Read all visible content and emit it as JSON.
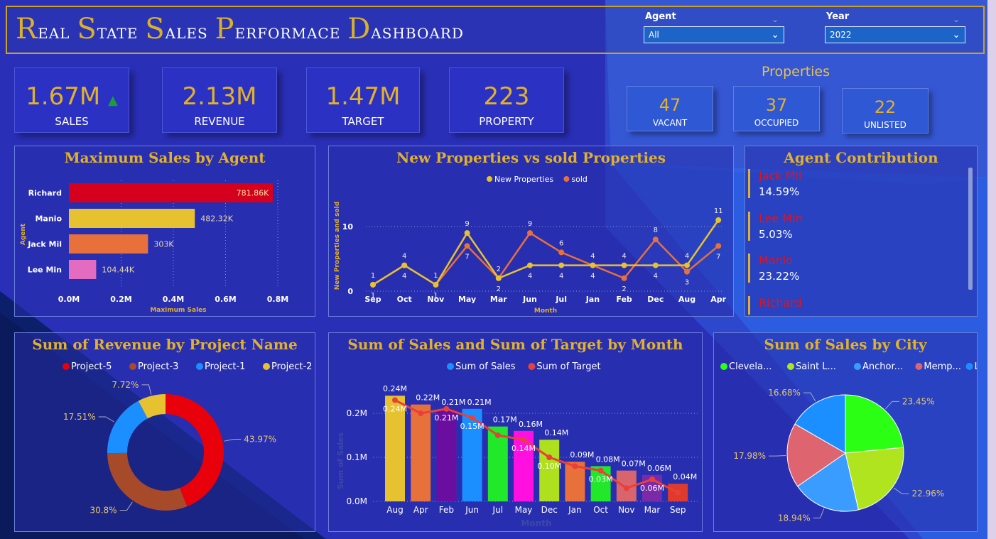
{
  "title": {
    "words": [
      {
        "cap": "R",
        "rest": "eal"
      },
      {
        "cap": "S",
        "rest": "tate"
      },
      {
        "cap": "S",
        "rest": "ales"
      },
      {
        "cap": "P",
        "rest": "erformace"
      },
      {
        "cap": "D",
        "rest": "ashboard"
      }
    ]
  },
  "filters": {
    "agent": {
      "label": "Agent",
      "value": "All"
    },
    "year": {
      "label": "Year",
      "value": "2022"
    }
  },
  "kpis": [
    {
      "value": "1.67M",
      "label": "SALES",
      "trend": "up"
    },
    {
      "value": "2.13M",
      "label": "REVENUE"
    },
    {
      "value": "1.47M",
      "label": "TARGET"
    },
    {
      "value": "223",
      "label": "PROPERTY"
    }
  ],
  "properties": {
    "title": "Properties",
    "items": [
      {
        "value": "47",
        "label": "VACANT"
      },
      {
        "value": "37",
        "label": "OCCUPIED"
      },
      {
        "value": "22",
        "label": "UNLISTED"
      }
    ]
  },
  "colors": {
    "gold": "#e1b12c",
    "red": "#e0141e",
    "accent": "#1c64c8"
  },
  "agent_contribution": {
    "title": "Agent Contribution",
    "items": [
      {
        "name": "Jack Mil",
        "pct": "14.59%"
      },
      {
        "name": "Lee Min",
        "pct": "5.03%"
      },
      {
        "name": "Manio",
        "pct": "23.22%"
      },
      {
        "name": "Richard",
        "pct": ""
      }
    ]
  },
  "chart_data": [
    {
      "id": "max-sales-by-agent",
      "type": "bar",
      "title": "Maximum Sales by Agent",
      "orientation": "horizontal",
      "ylabel": "Agent",
      "xlabel": "Maximum Sales",
      "categories": [
        "Richard",
        "Manio",
        "Jack Mil",
        "Lee Min"
      ],
      "values": [
        781860,
        482320,
        303000,
        104440
      ],
      "value_labels": [
        "781.86K",
        "482.32K",
        "303K",
        "104.44K"
      ],
      "colors": [
        "#d4001e",
        "#e6c130",
        "#e8703a",
        "#e46cc0"
      ],
      "xlim": [
        0,
        800000
      ],
      "xticks": [
        "0.0M",
        "0.2M",
        "0.4M",
        "0.6M",
        "0.8M"
      ]
    },
    {
      "id": "new-vs-sold",
      "type": "line",
      "title": "New Properties vs sold Properties",
      "xlabel": "Month",
      "ylabel": "New Properties and sold",
      "categories": [
        "Sep",
        "Oct",
        "Nov",
        "May",
        "Mar",
        "Jun",
        "Jul",
        "Jan",
        "Feb",
        "Dec",
        "Aug",
        "Apr"
      ],
      "ylim": [
        0,
        12
      ],
      "yticks": [
        "0",
        "10"
      ],
      "series": [
        {
          "name": "New Properties",
          "color": "#e6c130",
          "values": [
            1,
            4,
            1,
            9,
            2,
            4,
            4,
            4,
            4,
            4,
            4,
            11
          ]
        },
        {
          "name": "sold",
          "color": "#e8703a",
          "values": [
            1,
            4,
            1,
            7,
            2,
            9,
            6,
            4,
            2,
            8,
            3,
            7
          ]
        }
      ]
    },
    {
      "id": "revenue-by-project",
      "type": "pie",
      "title": "Sum of Revenue by Project Name",
      "categories": [
        "Project-5",
        "Project-3",
        "Project-1",
        "Project-2"
      ],
      "values": [
        43.97,
        30.8,
        17.51,
        7.72
      ],
      "labels": [
        "43.97%",
        "30.8%",
        "17.51%",
        "7.72%"
      ],
      "colors": [
        "#e8000b",
        "#a64a2a",
        "#1b8fff",
        "#e6c130"
      ],
      "donut": true
    },
    {
      "id": "sales-target-by-month",
      "type": "bar",
      "title": "Sum of Sales and Sum of Target by Month",
      "xlabel": "Month",
      "ylabel": "Sum of Sales",
      "categories": [
        "Aug",
        "Apr",
        "Feb",
        "Jun",
        "Jul",
        "May",
        "Dec",
        "Jan",
        "Oct",
        "Nov",
        "Mar",
        "Sep"
      ],
      "ylim": [
        0,
        0.25
      ],
      "yticks": [
        "0.0M",
        "0.1M",
        "0.2M"
      ],
      "series": [
        {
          "name": "Sum of Sales",
          "type": "bar",
          "values": [
            0.24,
            0.22,
            0.21,
            0.21,
            0.17,
            0.16,
            0.14,
            0.09,
            0.08,
            0.07,
            0.06,
            0.04
          ],
          "labels": [
            "0.24M",
            "0.22M",
            "0.21M",
            "0.21M",
            "0.17M",
            "0.16M",
            "0.14M",
            "0.09M",
            "0.08M",
            "0.07M",
            "0.06M",
            "0.04M"
          ]
        },
        {
          "name": "Sum of Target",
          "type": "line",
          "color": "#e8403a",
          "values": [
            0.23,
            0.2,
            0.21,
            0.19,
            0.15,
            0.14,
            0.1,
            0.08,
            0.07,
            0.03,
            0.05,
            0.02
          ],
          "labels": [
            "0.24M",
            "",
            "0.21M",
            "0.15M",
            "",
            "0.14M",
            "0.10M",
            "",
            "0.03M",
            "",
            "0.06M",
            ""
          ]
        }
      ],
      "colors": [
        "#e6c130",
        "#e8703a",
        "#6a0ea0",
        "#1b8fff",
        "#22e82a",
        "#ff10e0",
        "#aee01e",
        "#e8703a",
        "#22e82a",
        "#d8646c",
        "#7a2aa8",
        "#e03a2a"
      ]
    },
    {
      "id": "sales-by-city",
      "type": "pie",
      "title": "Sum of Sales by City",
      "categories": [
        "Clevela...",
        "Saint L...",
        "Anchor...",
        "Memp...",
        "Las Veg..."
      ],
      "values": [
        23.45,
        22.96,
        18.94,
        17.98,
        16.68
      ],
      "labels": [
        "23.45%",
        "22.96%",
        "18.94%",
        "17.98%",
        "16.68%"
      ],
      "colors": [
        "#2bff14",
        "#b0e41e",
        "#3a9cff",
        "#de6470",
        "#1b8fff"
      ]
    }
  ]
}
